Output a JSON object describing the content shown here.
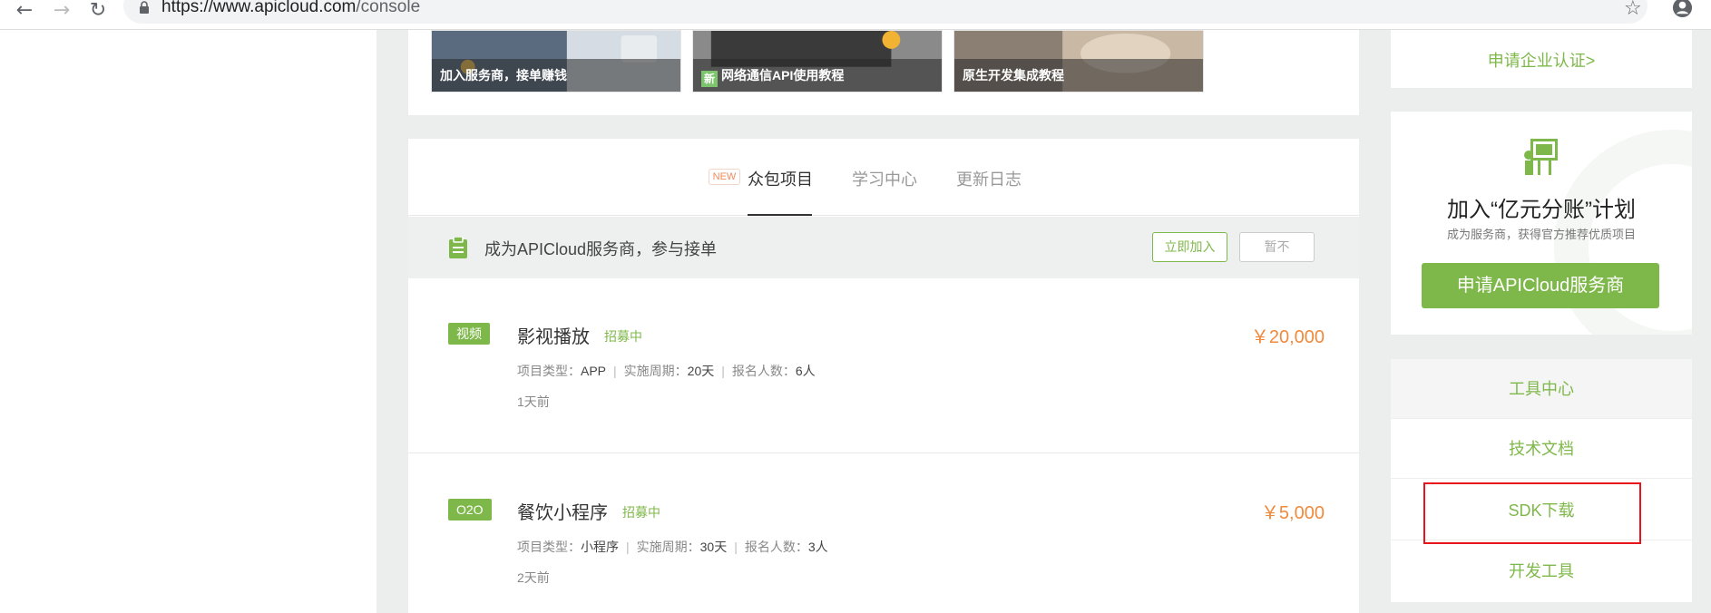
{
  "browser": {
    "url_host": "https://www.apicloud.com",
    "url_path": "/console"
  },
  "banners": [
    {
      "caption": "加入服务商，接单赚钱"
    },
    {
      "new_tag": "新",
      "caption": "网络通信API使用教程"
    },
    {
      "caption": "原生开发集成教程"
    }
  ],
  "tabs": {
    "new_badge": "NEW",
    "items": [
      {
        "label": "众包项目"
      },
      {
        "label": "学习中心"
      },
      {
        "label": "更新日志"
      }
    ]
  },
  "notice": {
    "text": "成为APICloud服务商，参与接单",
    "join_label": "立即加入",
    "later_label": "暂不"
  },
  "projects": [
    {
      "category": "视频",
      "title": "影视播放",
      "status": "招募中",
      "type_label": "项目类型：",
      "type_value": "APP",
      "period_label": "实施周期：",
      "period_value": "20天",
      "signup_label": "报名人数：",
      "signup_value": "6人",
      "time": "1天前",
      "price": "￥20,000"
    },
    {
      "category": "O2O",
      "title": "餐饮小程序",
      "status": "招募中",
      "type_label": "项目类型：",
      "type_value": "小程序",
      "period_label": "实施周期：",
      "period_value": "30天",
      "signup_label": "报名人数：",
      "signup_value": "3人",
      "time": "2天前",
      "price": "￥5,000"
    }
  ],
  "sidebar": {
    "enterprise_link": "申请企业认证>",
    "promo_title": "加入“亿元分账”计划",
    "promo_sub": "成为服务商，获得官方推荐优质项目",
    "promo_button": "申请APICloud服务商",
    "tools": [
      {
        "label": "工具中心"
      },
      {
        "label": "技术文档"
      },
      {
        "label": "SDK下载"
      },
      {
        "label": "开发工具"
      }
    ]
  },
  "colors": {
    "accent_green": "#7fb84a",
    "price_orange": "#f08a3c",
    "highlight_red": "#e8141b"
  }
}
